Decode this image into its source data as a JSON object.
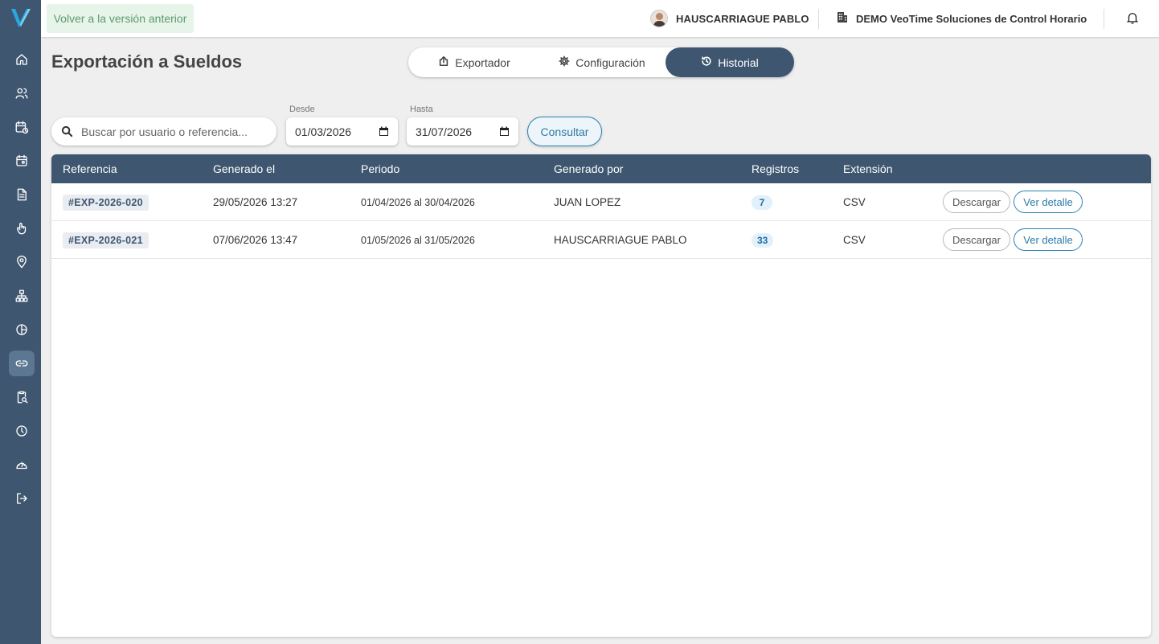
{
  "topbar": {
    "old_version_label": "Volver a la versión anterior",
    "user_name": "HAUSCARRIAGUE PABLO",
    "company_name": "DEMO VeoTime Soluciones de Control Horario"
  },
  "page": {
    "title": "Exportación a Sueldos"
  },
  "tabs": [
    {
      "label": "Exportador",
      "icon": "export-icon",
      "active": false
    },
    {
      "label": "Configuración",
      "icon": "gear-icon",
      "active": false
    },
    {
      "label": "Historial",
      "icon": "history-icon",
      "active": true
    }
  ],
  "filters": {
    "search_placeholder": "Buscar por usuario o referencia...",
    "from_label": "Desde",
    "from_value": "01/03/2026",
    "to_label": "Hasta",
    "to_value": "31/07/2026",
    "consult_label": "Consultar"
  },
  "table": {
    "columns": [
      "Referencia",
      "Generado el",
      "Periodo",
      "Generado por",
      "Registros",
      "Extensión"
    ],
    "rows": [
      {
        "ref": "#EXP-2026-020",
        "generated_at": "29/05/2026 13:27",
        "period": "01/04/2026 al 30/04/2026",
        "generated_by": "JUAN LOPEZ",
        "records": "7",
        "extension": "CSV"
      },
      {
        "ref": "#EXP-2026-021",
        "generated_at": "07/06/2026 13:47",
        "period": "01/05/2026 al 31/05/2026",
        "generated_by": "HAUSCARRIAGUE PABLO",
        "records": "33",
        "extension": "CSV"
      }
    ],
    "download_label": "Descargar",
    "detail_label": "Ver detalle"
  },
  "sidebar": {
    "items": [
      {
        "icon": "home-icon"
      },
      {
        "icon": "users-icon"
      },
      {
        "icon": "calendar-clock-icon"
      },
      {
        "icon": "calendar-icon"
      },
      {
        "icon": "document-icon"
      },
      {
        "icon": "hand-pointer-icon"
      },
      {
        "icon": "location-pin-icon"
      },
      {
        "icon": "org-chart-icon"
      },
      {
        "icon": "pie-chart-icon"
      },
      {
        "icon": "link-icon",
        "active": true
      },
      {
        "icon": "clipboard-search-icon"
      },
      {
        "icon": "clock-icon"
      },
      {
        "icon": "speedometer-icon"
      },
      {
        "icon": "logout-icon"
      }
    ]
  },
  "colors": {
    "sidebar": "#3e566f",
    "accent": "#2b85b3",
    "old_version_bg": "#e6f4ea"
  }
}
